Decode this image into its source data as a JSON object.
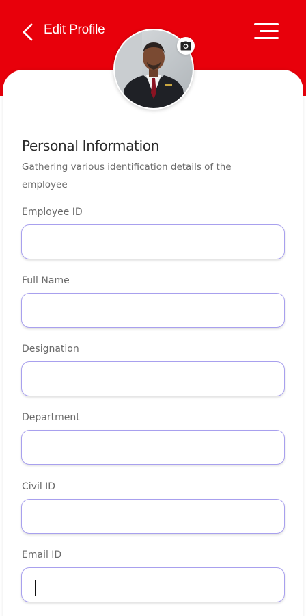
{
  "header": {
    "title": "Edit Profile",
    "back_icon": "chevron-left-icon",
    "menu_icon": "menu-icon",
    "background_color": "#e8000b"
  },
  "profile": {
    "avatar_icon": "profile-photo",
    "camera_icon": "camera-icon"
  },
  "section": {
    "title": "Personal Information",
    "description": "Gathering various identification details of the employee"
  },
  "form": {
    "employee_id_label": "Employee ID",
    "employee_id_value": "",
    "full_name_label": "Full Name",
    "full_name_value": "",
    "designation_label": "Designation",
    "designation_value": "",
    "department_label": "Department",
    "department_value": "",
    "civil_id_label": "Civil ID",
    "civil_id_value": "",
    "email_id_label": "Email ID",
    "email_id_value": "",
    "input_border_color": "#a8a0ee"
  }
}
